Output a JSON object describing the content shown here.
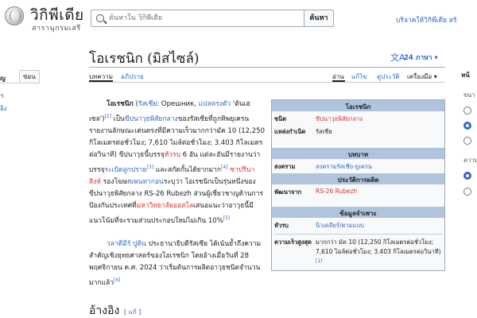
{
  "header": {
    "logo_title": "วิกิพีเดีย",
    "logo_subtitle": "สารานุกรมเสรี",
    "search_placeholder": "ค้นหาใน วิกิพีเดีย",
    "search_button": "ค้นหา",
    "donate": "บริจาคให้วิกิพีเดีย สร้"
  },
  "sidebar": {
    "label": "ญ",
    "hide_button": "ซ่อน",
    "item1": "ำ",
    "item2": "อิง"
  },
  "title": {
    "text": "โอเรชนิก (มิสไซล์)",
    "languages_icon": "文A",
    "languages": "24 ภาษา ▾"
  },
  "tabs": {
    "article": "บทความ",
    "talk": "อภิปราย",
    "read": "อ่าน",
    "edit": "แก้ไข",
    "history": "ดูประวัติ",
    "tools": "เครื่องมือ ▾"
  },
  "right_panel": {
    "head": "หน้",
    "sub1": "ขนา",
    "sub2": "ความ"
  },
  "paragraph1": {
    "bold": "โอเรชนิก",
    "t1": " (",
    "l1": "รัสเซีย",
    "t2": ": Орешник, ",
    "l2": "แปลตรงตัว",
    "t3": " 'ต้นเฮเซล')",
    "ref1": "[2]",
    "t4": " เป็น",
    "l3": "ขีปนาวุธพิสัยกลาง",
    "t5": "ของรัสเซียที่ถูกทิพยุเครนรายงานลักษณะเด่นตรงที่มีความเร็วมากกว่ามัค 10 (12,250 กิโลเมตรต่อชั่วโมง; 7,610 ไมล์ต่อชั่วโมง; 3.403 กิโลเมตรต่อวินาที) ขีปนาวุธนี้บรรจุ",
    "l4": "หัวรบ",
    "t6": " 6 อัน แต่ละอันมีรายงานว่าบรรจุ",
    "l5": "ระเบิดลูกปราย",
    "ref2": "[3]",
    "t7": " และสกัดกั้นได้ยากมาก",
    "ref3": "[4]",
    "t8": " ",
    "l6": "ซาปรีนา สิงห์",
    "t9": " รองโฆษก",
    "l7": "เพนทากอน",
    "t10": "ระบุว่า โอเรชนิกเป็นรุ่นหนึ่งของขีปนาวุธพิสัยกลาง RS-26 Rubezh ส่วนผู้เชี่ยวชาญด้านการป้องกันประเทศที่",
    "l8": "มหาวิทยาลัยออสโล",
    "t11": "เสนอแนะว่าอาวุธนี้มีแนวโน้มที่จะรวมส่วนประกอบใหม่ไม่เกิน 10%",
    "ref4": "[5]"
  },
  "paragraph2": {
    "l1": "วลาดีมีร์ ปูติน",
    "t1": " ประธานาธิบดีรัสเซีย ได้เน้นย้ำถึงความสำคัญเชิงยุทธศาสตร์ของโอเรชนิก โดยอ้างเมื่อวันที่ 28 พฤศจิกายน ค.ศ. 2024 ว่าเริ่มต้นการผลิตอาวุธชนิดจำนวนมากแล้ว",
    "ref": "[6]"
  },
  "section": {
    "heading": "อ้างอิง",
    "edit_open": "[ ",
    "edit_link": "แก้",
    "edit_close": " ]"
  },
  "infobox": {
    "title": "โอเรชนิก",
    "rows1": [
      {
        "label": "ชนิด",
        "value": "ขีปนาวุธพิสัยกลาง",
        "link": true
      },
      {
        "label": "แหล่งกำเนิด",
        "value": "รัสเซีย",
        "link": false
      }
    ],
    "section_service": "บทบาท",
    "war": {
      "label": "สงคราม",
      "value": "สงครามรัสเซีย-ยูเครน"
    },
    "section_production": "ประวัติการผลิต",
    "developed": {
      "label": "พัฒนาจาก",
      "value": "RS-26 Rubezh"
    },
    "section_specs": "ข้อมูลจำเพาะ",
    "guidance": {
      "label": "หัวรบ",
      "value": "นิวเคลียร์/ตามแบบ"
    },
    "speed": {
      "label": "ความเร็วสูงสุด",
      "value": "มากกว่า มัค 10 (12,250 กิโลเมตรต่อชั่วโมง; 7,610 ไมล์ต่อชั่วโมง; 3.403 กิโลเมตรต่อวินาที)",
      "ref": "[1]"
    }
  }
}
